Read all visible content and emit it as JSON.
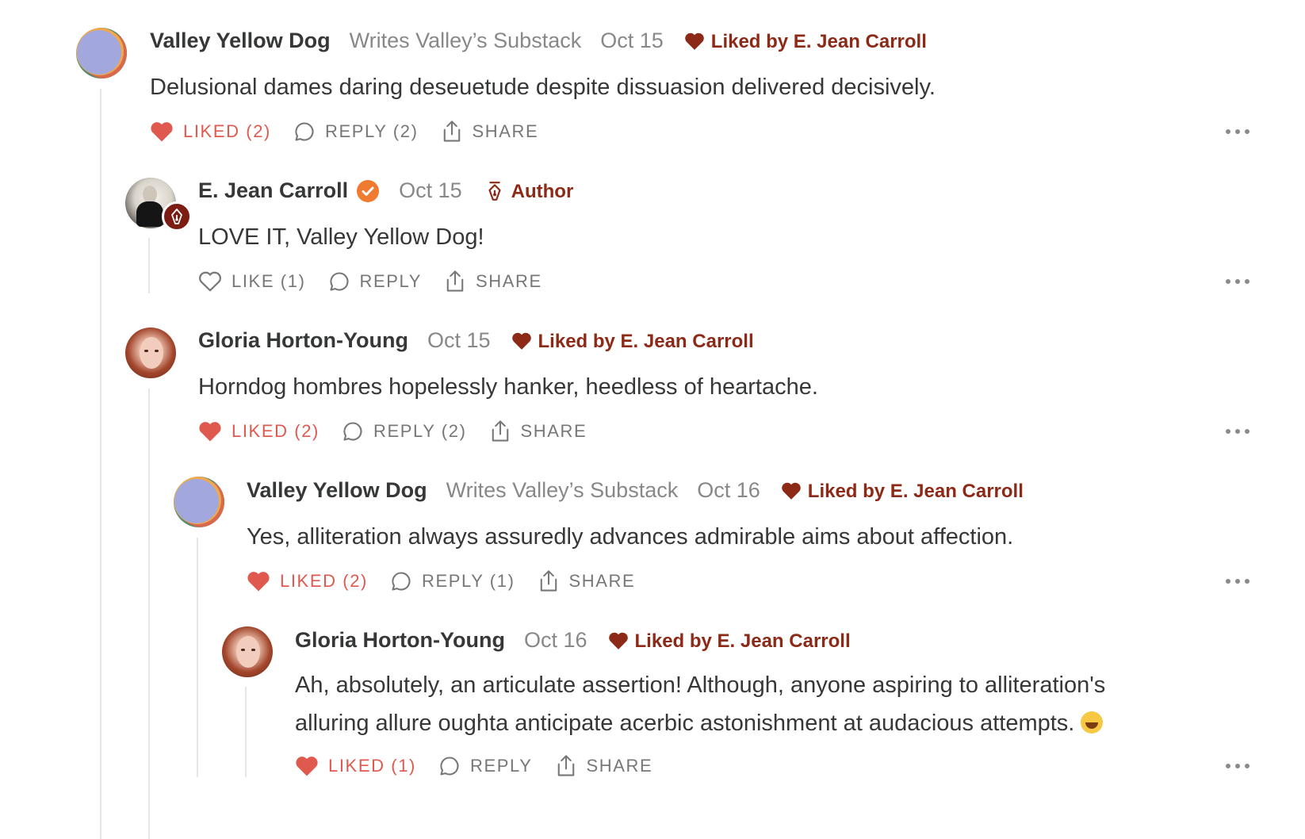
{
  "comments": [
    {
      "author": "Valley Yellow Dog",
      "subtitle": "Writes Valley’s Substack",
      "date": "Oct 15",
      "liked_by": "Liked by E. Jean Carroll",
      "body": [
        "Delusional dames daring deseuetude despite dissuasion delivered decisively."
      ],
      "like_label": "LIKED (2)",
      "reply_label": "REPLY (2)",
      "share_label": "SHARE"
    },
    {
      "author": "E. Jean Carroll",
      "date": "Oct 15",
      "author_tag": "Author",
      "body": [
        "LOVE IT, Valley Yellow Dog!"
      ],
      "like_label": "LIKE (1)",
      "reply_label": "REPLY",
      "share_label": "SHARE"
    },
    {
      "author": "Gloria Horton-Young",
      "date": "Oct 15",
      "liked_by": "Liked by E. Jean Carroll",
      "body": [
        "Horndog hombres hopelessly hanker, heedless of heartache."
      ],
      "like_label": "LIKED (2)",
      "reply_label": "REPLY (2)",
      "share_label": "SHARE"
    },
    {
      "author": "Valley Yellow Dog",
      "subtitle": "Writes Valley’s Substack",
      "date": "Oct 16",
      "liked_by": "Liked by E. Jean Carroll",
      "body": [
        "Yes, alliteration always assuredly advances admirable aims about affection."
      ],
      "like_label": "LIKED (2)",
      "reply_label": "REPLY (1)",
      "share_label": "SHARE"
    },
    {
      "author": "Gloria Horton-Young",
      "date": "Oct 16",
      "liked_by": "Liked by E. Jean Carroll",
      "body": [
        "Ah, absolutely, an articulate assertion! Although, anyone aspiring to alliteration's",
        "alluring allure oughta anticipate acerbic astonishment at audacious attempts."
      ],
      "like_label": "LIKED (1)",
      "reply_label": "REPLY",
      "share_label": "SHARE"
    }
  ],
  "colors": {
    "liked": "#e0594e",
    "liked_by": "#8c2a17",
    "verified": "#f07a2f",
    "meta": "#888888",
    "text": "#363737"
  },
  "icons": [
    "heart-icon",
    "comment-icon",
    "share-icon",
    "more-icon",
    "verified-badge-icon",
    "pen-nib-icon",
    "laughing-emoji-icon"
  ]
}
